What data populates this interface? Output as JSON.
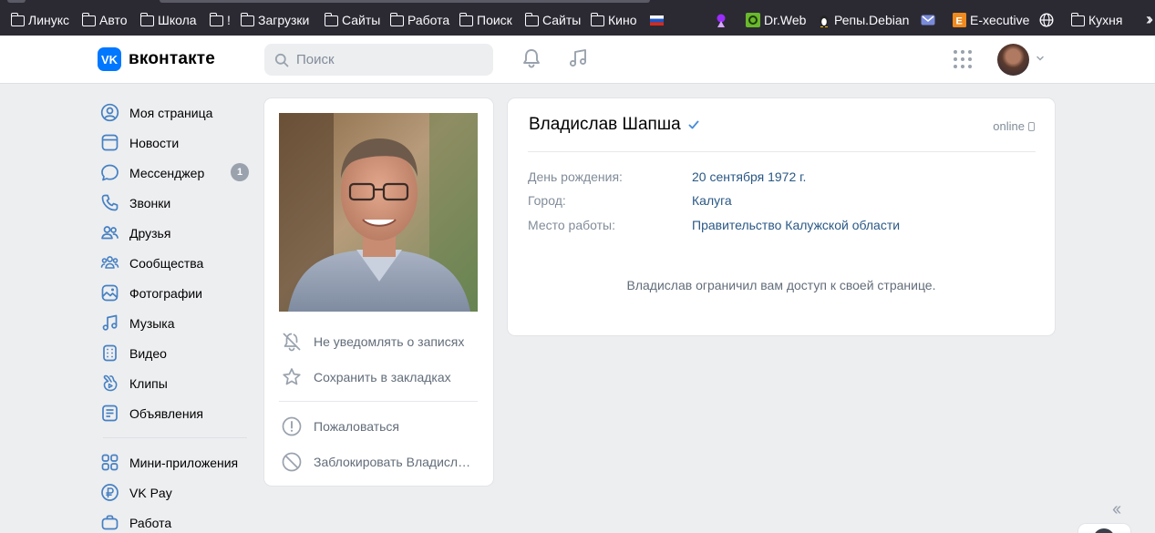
{
  "bookmarks": [
    {
      "label": "Линукс",
      "icon": "folder-icon"
    },
    {
      "label": "Авто",
      "icon": "folder-icon"
    },
    {
      "label": "Школа",
      "icon": "folder-icon"
    },
    {
      "label": "!",
      "icon": "folder-icon"
    },
    {
      "label": "Загрузки",
      "icon": "folder-icon"
    },
    {
      "label": "Сайты",
      "icon": "folder-icon"
    },
    {
      "label": "Работа",
      "icon": "folder-icon"
    },
    {
      "label": "Поиск",
      "icon": "folder-icon"
    },
    {
      "label": "Сайты",
      "icon": "folder-icon"
    },
    {
      "label": "Кино",
      "icon": "folder-icon"
    },
    {
      "label": "",
      "icon": "russian-flag-icon"
    },
    {
      "label": "",
      "icon": "purple-bookmark-icon"
    },
    {
      "label": "Dr.Web",
      "icon": "drweb-icon"
    },
    {
      "label": "Репы.Debian",
      "icon": "tux-icon"
    },
    {
      "label": "",
      "icon": "mail-icon"
    },
    {
      "label": "E-xecutive",
      "icon": "executive-icon"
    },
    {
      "label": "",
      "icon": "globe-icon"
    },
    {
      "label": "Кухня",
      "icon": "folder-icon"
    }
  ],
  "header": {
    "logo_text": "вконтакте",
    "logo_mark": "VK",
    "search_placeholder": "Поиск"
  },
  "nav": {
    "items": [
      {
        "label": "Моя страница",
        "icon": "user-circle-icon"
      },
      {
        "label": "Новости",
        "icon": "news-icon"
      },
      {
        "label": "Мессенджер",
        "icon": "message-icon",
        "badge": "1"
      },
      {
        "label": "Звонки",
        "icon": "phone-icon"
      },
      {
        "label": "Друзья",
        "icon": "friends-icon"
      },
      {
        "label": "Сообщества",
        "icon": "communities-icon"
      },
      {
        "label": "Фотографии",
        "icon": "photos-icon"
      },
      {
        "label": "Музыка",
        "icon": "music-icon"
      },
      {
        "label": "Видео",
        "icon": "video-icon"
      },
      {
        "label": "Клипы",
        "icon": "clips-icon"
      },
      {
        "label": "Объявления",
        "icon": "classifieds-icon"
      }
    ],
    "items2": [
      {
        "label": "Мини-приложения",
        "icon": "mini-apps-icon"
      },
      {
        "label": "VK Pay",
        "icon": "vkpay-icon"
      },
      {
        "label": "Работа",
        "icon": "work-icon"
      }
    ]
  },
  "profile": {
    "name": "Владислав Шапша",
    "status": "online",
    "actions": {
      "mute": "Не уведомлять о записях",
      "bookmark": "Сохранить в закладках",
      "report": "Пожаловаться",
      "block": "Заблокировать Владисл…"
    },
    "info": [
      {
        "key": "День рождения:",
        "value": "20 сентября 1972 г."
      },
      {
        "key": "Город:",
        "value": "Калуга"
      },
      {
        "key": "Место работы:",
        "value": "Правительство Калужской области"
      }
    ],
    "restricted_text": "Владислав ограничил вам доступ к своей странице."
  },
  "colors": {
    "accent": "#0077ff",
    "link": "#2a5885",
    "secondary": "#818c99",
    "background": "#edeef0",
    "bookmarks_bar": "#2b2a33"
  }
}
